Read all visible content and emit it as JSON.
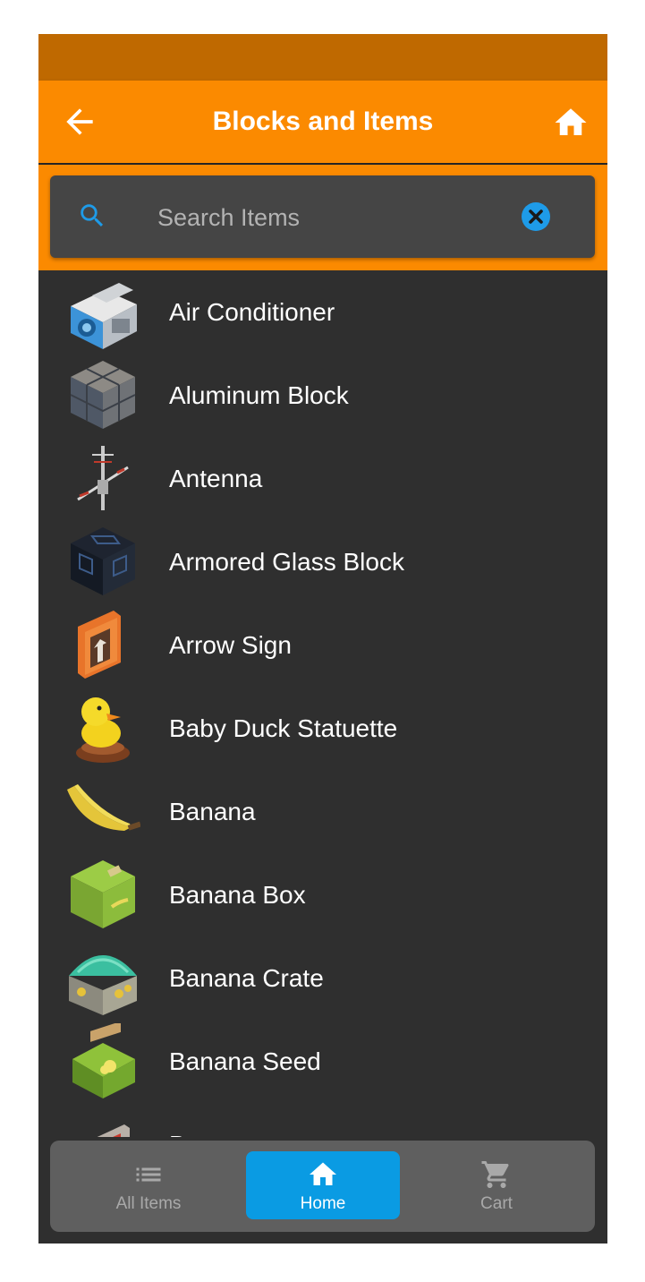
{
  "header": {
    "title": "Blocks and Items",
    "back_icon": "arrow-left-icon",
    "home_icon": "home-icon"
  },
  "search": {
    "placeholder": "Search Items",
    "value": "",
    "search_icon": "search-icon",
    "clear_icon": "clear-icon"
  },
  "colors": {
    "accent": "#fb8a00",
    "statusbar": "#bf6900",
    "background": "#2f2f2f",
    "nav_active": "#0a9be3"
  },
  "items": [
    {
      "label": "Air Conditioner"
    },
    {
      "label": "Aluminum Block"
    },
    {
      "label": "Antenna"
    },
    {
      "label": "Armored Glass Block"
    },
    {
      "label": "Arrow Sign"
    },
    {
      "label": "Baby Duck Statuette"
    },
    {
      "label": "Banana"
    },
    {
      "label": "Banana Box"
    },
    {
      "label": "Banana Crate"
    },
    {
      "label": "Banana Seed"
    },
    {
      "label": "Banner"
    }
  ],
  "nav": {
    "all_items": {
      "label": "All Items",
      "icon": "list-icon"
    },
    "home": {
      "label": "Home",
      "icon": "home-icon",
      "selected": true
    },
    "cart": {
      "label": "Cart",
      "icon": "cart-icon"
    }
  }
}
